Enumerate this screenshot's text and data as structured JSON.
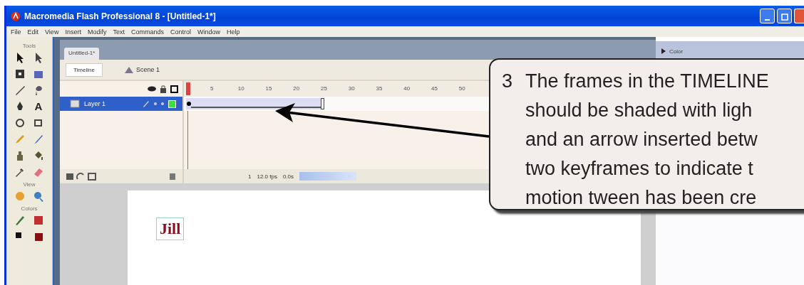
{
  "window": {
    "title": "Macromedia Flash Professional 8 - [Untitled-1*]"
  },
  "menu": [
    "File",
    "Edit",
    "View",
    "Insert",
    "Modify",
    "Text",
    "Commands",
    "Control",
    "Window",
    "Help"
  ],
  "tools": {
    "title": "Tools",
    "items": [
      {
        "kind": "arrow"
      },
      {
        "kind": "subselect"
      },
      {
        "kind": "transform"
      },
      {
        "kind": "gradient"
      },
      {
        "kind": "line"
      },
      {
        "kind": "lasso"
      },
      {
        "kind": "pen"
      },
      {
        "kind": "text",
        "label": "A"
      },
      {
        "kind": "oval"
      },
      {
        "kind": "rect"
      },
      {
        "kind": "pencil"
      },
      {
        "kind": "brush"
      },
      {
        "kind": "inkbottle"
      },
      {
        "kind": "bucket"
      },
      {
        "kind": "dropper"
      },
      {
        "kind": "eraser"
      }
    ]
  },
  "view": {
    "title": "View",
    "items": [
      {
        "kind": "hand"
      },
      {
        "kind": "zoom"
      }
    ]
  },
  "colors": {
    "title": "Colors",
    "items": [
      {
        "kind": "stroke"
      },
      {
        "kind": "fill"
      },
      {
        "kind": "swap"
      },
      {
        "kind": "swatch"
      }
    ]
  },
  "document_tab": {
    "label": "Untitled-1*"
  },
  "timeline": {
    "button": "Timeline",
    "scene": "Scene 1",
    "frame_numbers": [
      "5",
      "10",
      "15",
      "20",
      "25",
      "30",
      "35",
      "40",
      "45",
      "50"
    ],
    "layers": [
      {
        "name": "Layer 1",
        "selected": true
      }
    ],
    "current_frame": "1",
    "frame_rate": "12.0 fps",
    "elapsed": "0.0s"
  },
  "stage": {
    "text": "Jill"
  },
  "right_panel": {
    "title": "Color"
  },
  "callout": {
    "number": "3",
    "lines": [
      "The frames in the TIMELINE",
      "should be shaded with ligh",
      "and an arrow inserted betw",
      "two keyframes to indicate t",
      "motion tween has been cre"
    ]
  }
}
